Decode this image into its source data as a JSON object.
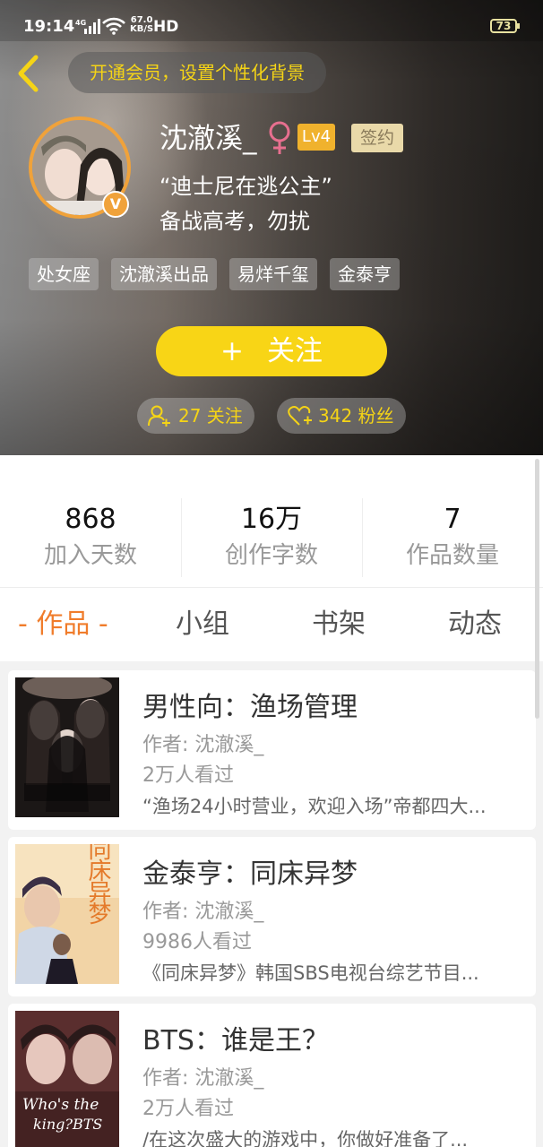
{
  "status_bar": {
    "time": "19:14",
    "network": "4G",
    "speed_value": "67.0",
    "speed_unit": "KB/S",
    "hd": "HD",
    "battery": "73"
  },
  "header": {
    "vip_prompt": "开通会员，设置个性化背景",
    "avatar_icon": "user-avatar-photo",
    "verified_badge": "V",
    "username": "沈澈溪_",
    "gender": "♀",
    "level": "Lv4",
    "sign_badge": "签约",
    "motto_line1": "“迪士尼在逃公主”",
    "motto_line2": "备战高考，勿扰",
    "tags": [
      "处女座",
      "沈澈溪出品",
      "易烊千玺",
      "金泰亨"
    ],
    "follow_label": "关注",
    "follow_plus": "+",
    "following_text": "27 关注",
    "fans_text": "342 粉丝",
    "accent_color": "#f8d516"
  },
  "stats": [
    {
      "value": "868",
      "label": "加入天数"
    },
    {
      "value": "16万",
      "label": "创作字数"
    },
    {
      "value": "7",
      "label": "作品数量"
    }
  ],
  "tabs": [
    {
      "label": "- 作品 -",
      "active": true
    },
    {
      "label": "小组",
      "active": false
    },
    {
      "label": "书架",
      "active": false
    },
    {
      "label": "动态",
      "active": false
    }
  ],
  "works": [
    {
      "title": "男性向：渔场管理",
      "author": "作者: 沈澈溪_",
      "views": "2万人看过",
      "desc": "“渔场24小时营业，欢迎入场”帝都四大..."
    },
    {
      "title": "金泰亨：同床异梦",
      "author": "作者: 沈澈溪_",
      "views": "9986人看过",
      "desc": "《同床异梦》韩国SBS电视台综艺节目..."
    },
    {
      "title": "BTS：谁是王？",
      "author": "作者: 沈澈溪_",
      "views": "2万人看过",
      "desc": "/在这次盛大的游戏中，你做好准备了..."
    }
  ],
  "cover_texts": {
    "cover2_word": "同床异梦",
    "cover3_line1": "Who's the",
    "cover3_line2": "king?BTS"
  }
}
